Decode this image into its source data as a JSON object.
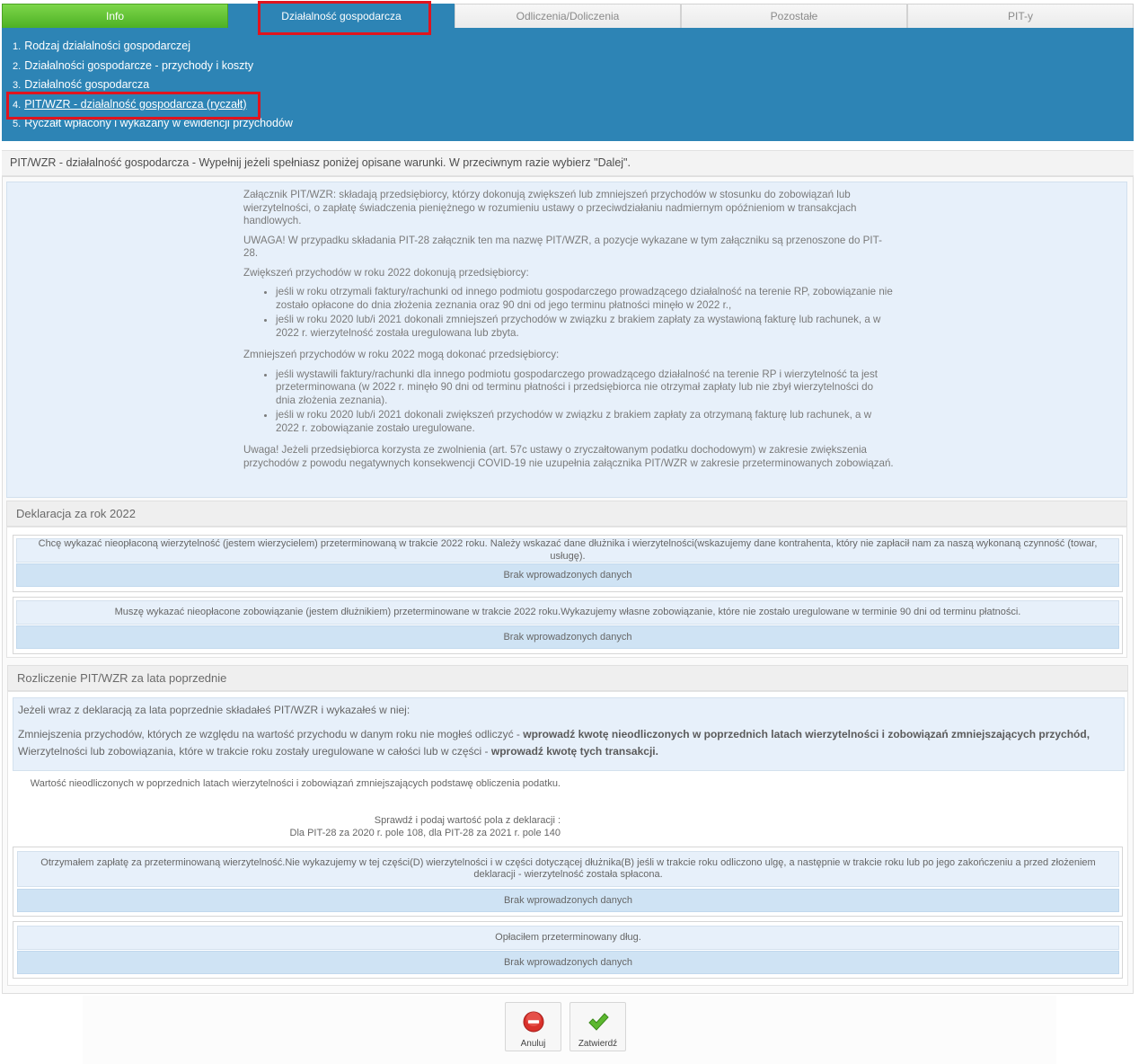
{
  "tabs": [
    {
      "label": "Info"
    },
    {
      "label": "Działalność gospodarcza"
    },
    {
      "label": "Odliczenia/Doliczenia"
    },
    {
      "label": "Pozostałe"
    },
    {
      "label": "PIT-y"
    }
  ],
  "steps": [
    {
      "num": "1.",
      "label": "Rodzaj działalności gospodarczej"
    },
    {
      "num": "2.",
      "label": "Działalności gospodarcze - przychody i koszty"
    },
    {
      "num": "3.",
      "label": "Działalność gospodarcza"
    },
    {
      "num": "4.",
      "label": "PIT/WZR - działalność gospodarcza (ryczałt)"
    },
    {
      "num": "5.",
      "label": "Ryczałt wpłacony i wykazany w ewidencji przychodów"
    }
  ],
  "intro": "PIT/WZR - działalność gospodarcza - Wypełnij jeżeli spełniasz poniżej opisane warunki. W przeciwnym razie wybierz \"Dalej\".",
  "info": {
    "p1": "Załącznik PIT/WZR: składają przedsiębiorcy, którzy dokonują zwiększeń lub zmniejszeń przychodów w stosunku do zobowiązań lub wierzytelności, o zapłatę świadczenia pieniężnego w rozumieniu ustawy o przeciwdziałaniu nadmiernym opóźnieniom w transakcjach handlowych.",
    "p2": "UWAGA! W przypadku składania PIT-28 załącznik ten ma nazwę PIT/WZR, a pozycje wykazane w tym załączniku są przenoszone do PIT-28.",
    "p3": "Zwiększeń przychodów w roku 2022 dokonują przedsiębiorcy:",
    "list1": [
      "jeśli w roku otrzymali faktury/rachunki od innego podmiotu gospodarczego prowadzącego działalność na terenie RP, zobowiązanie nie zostało opłacone do dnia złożenia zeznania oraz 90 dni od jego terminu płatności minęło w 2022 r.,",
      "jeśli w roku 2020 lub/i 2021 dokonali zmniejszeń przychodów w związku z brakiem zapłaty za wystawioną fakturę lub rachunek, a w 2022 r. wierzytelność została uregulowana lub zbyta."
    ],
    "p4": "Zmniejszeń przychodów w roku 2022 mogą dokonać przedsiębiorcy:",
    "list2": [
      "jeśli wystawili faktury/rachunki dla innego podmiotu gospodarczego prowadzącego działalność na terenie RP i wierzytelność ta jest przeterminowana (w 2022 r. minęło 90 dni od terminu płatności i przedsiębiorca nie otrzymał zapłaty lub nie zbył wierzytelności do dnia złożenia zeznania).",
      "jeśli w roku 2020 lub/i 2021 dokonali zwiększeń przychodów w związku z brakiem zapłaty za otrzymaną fakturę lub rachunek, a w 2022 r. zobowiązanie zostało uregulowane."
    ],
    "p5": "Uwaga! Jeżeli przedsiębiorca korzysta ze zwolnienia (art. 57c ustawy o zryczałtowanym podatku dochodowym) w zakresie zwiększenia przychodów z powodu negatywnych konsekwencji COVID-19 nie uzupełnia załącznika PIT/WZR w zakresie przeterminowanych zobowiązań."
  },
  "section1": {
    "title": "Deklaracja za rok 2022",
    "card1_desc": "Chcę wykazać nieopłaconą wierzytelność (jestem wierzycielem) przeterminowaną w trakcie 2022 roku. Należy wskazać dane dłużnika i wierzytelności(wskazujemy dane kontrahenta, który nie zapłacił nam za naszą wykonaną czynność (towar, usługę).",
    "card2_desc": "Muszę wykazać nieopłacone zobowiązanie (jestem dłużnikiem) przeterminowane w trakcie 2022 roku.Wykazujemy własne zobowiązanie, które nie zostało uregulowane w terminie 90 dni od terminu płatności."
  },
  "nodata": "Brak wprowadzonych danych",
  "section2": {
    "title": "Rozliczenie PIT/WZR za lata poprzednie",
    "line1": "Jeżeli wraz z deklaracją za lata poprzednie składałeś PIT/WZR i wykazałeś w niej:",
    "line2_plain": "Zmniejszenia przychodów, których ze względu na wartość przychodu w danym roku nie mogłeś odliczyć - ",
    "line2_bold": "wprowadź kwotę nieodliczonych w poprzednich latach wierzytelności i zobowiązań zmniejszających przychód,",
    "line3_plain": "Wierzytelności lub zobowiązania, które w trakcie roku zostały uregulowane w całości lub w części - ",
    "line3_bold": "wprowadź kwotę tych transakcji.",
    "field_label": "Wartość nieodliczonych w poprzednich latach wierzytelności i zobowiązań zmniejszających podstawę obliczenia podatku.",
    "field_hint1": "Sprawdź i podaj wartość pola z deklaracji :",
    "field_hint2": "Dla PIT-28 za 2020 r. pole 108, dla PIT-28 za 2021 r. pole 140",
    "card3_desc": "Otrzymałem zapłatę za przeterminowaną wierzytelność.Nie wykazujemy w tej części(D) wierzytelności i w części dotyczącej dłużnika(B) jeśli w trakcie roku odliczono ulgę, a następnie w trakcie roku lub po jego zakończeniu a przed złożeniem deklaracji - wierzytelność została spłacona.",
    "card4_desc": "Opłaciłem przeterminowany dług."
  },
  "buttons": {
    "cancel": "Anuluj",
    "confirm": "Zatwierdź"
  },
  "colors": {
    "accent_blue": "#2d84b5",
    "info_green": "#4db124",
    "highlight_red": "#e0141e"
  }
}
